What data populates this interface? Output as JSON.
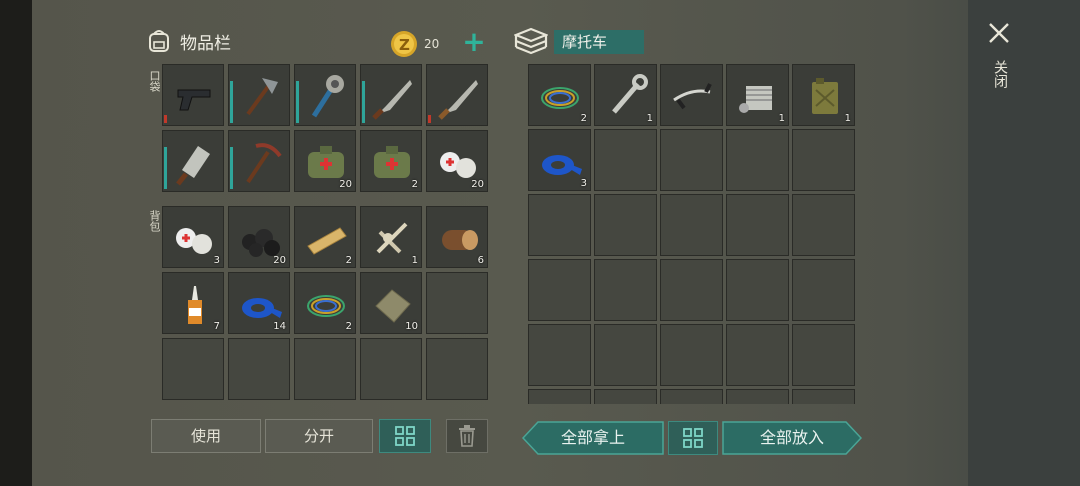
{
  "inventory": {
    "title": "物品栏",
    "coins": "20",
    "pocket_label": "口袋",
    "backpack_label": "背包",
    "pocket_slots": [
      {
        "item": "pistol",
        "qty": ""
      },
      {
        "item": "hatchet",
        "qty": ""
      },
      {
        "item": "spiked-club",
        "qty": ""
      },
      {
        "item": "machete",
        "qty": ""
      },
      {
        "item": "machete-rusty",
        "qty": ""
      },
      {
        "item": "cleaver",
        "qty": ""
      },
      {
        "item": "pickaxe",
        "qty": ""
      },
      {
        "item": "medkit",
        "qty": "20"
      },
      {
        "item": "medkit",
        "qty": "2"
      },
      {
        "item": "bandage",
        "qty": "20"
      }
    ],
    "backpack_slots": [
      {
        "item": "bandage",
        "qty": "3"
      },
      {
        "item": "coal",
        "qty": "20"
      },
      {
        "item": "plank",
        "qty": "2"
      },
      {
        "item": "bones",
        "qty": "1"
      },
      {
        "item": "log",
        "qty": "6"
      },
      {
        "item": "glue",
        "qty": "7"
      },
      {
        "item": "tape",
        "qty": "14"
      },
      {
        "item": "wire",
        "qty": "2"
      },
      {
        "item": "cloth",
        "qty": "10"
      },
      {
        "item": "empty",
        "qty": ""
      },
      {
        "item": "empty",
        "qty": ""
      },
      {
        "item": "empty",
        "qty": ""
      },
      {
        "item": "empty",
        "qty": ""
      },
      {
        "item": "empty",
        "qty": ""
      },
      {
        "item": "empty",
        "qty": ""
      }
    ],
    "use_label": "使用",
    "split_label": "分开"
  },
  "vehicle": {
    "name": "摩托车",
    "slots": [
      {
        "item": "wire",
        "qty": "2"
      },
      {
        "item": "wrench",
        "qty": "1"
      },
      {
        "item": "handlebar",
        "qty": ""
      },
      {
        "item": "engine",
        "qty": "1"
      },
      {
        "item": "jerrycan",
        "qty": "1"
      },
      {
        "item": "tape",
        "qty": "3"
      }
    ],
    "take_all_label": "全部拿上",
    "put_all_label": "全部放入"
  },
  "close_label": "关闭",
  "colors": {
    "accent": "#2d6e67",
    "plus": "#2fb39a"
  }
}
